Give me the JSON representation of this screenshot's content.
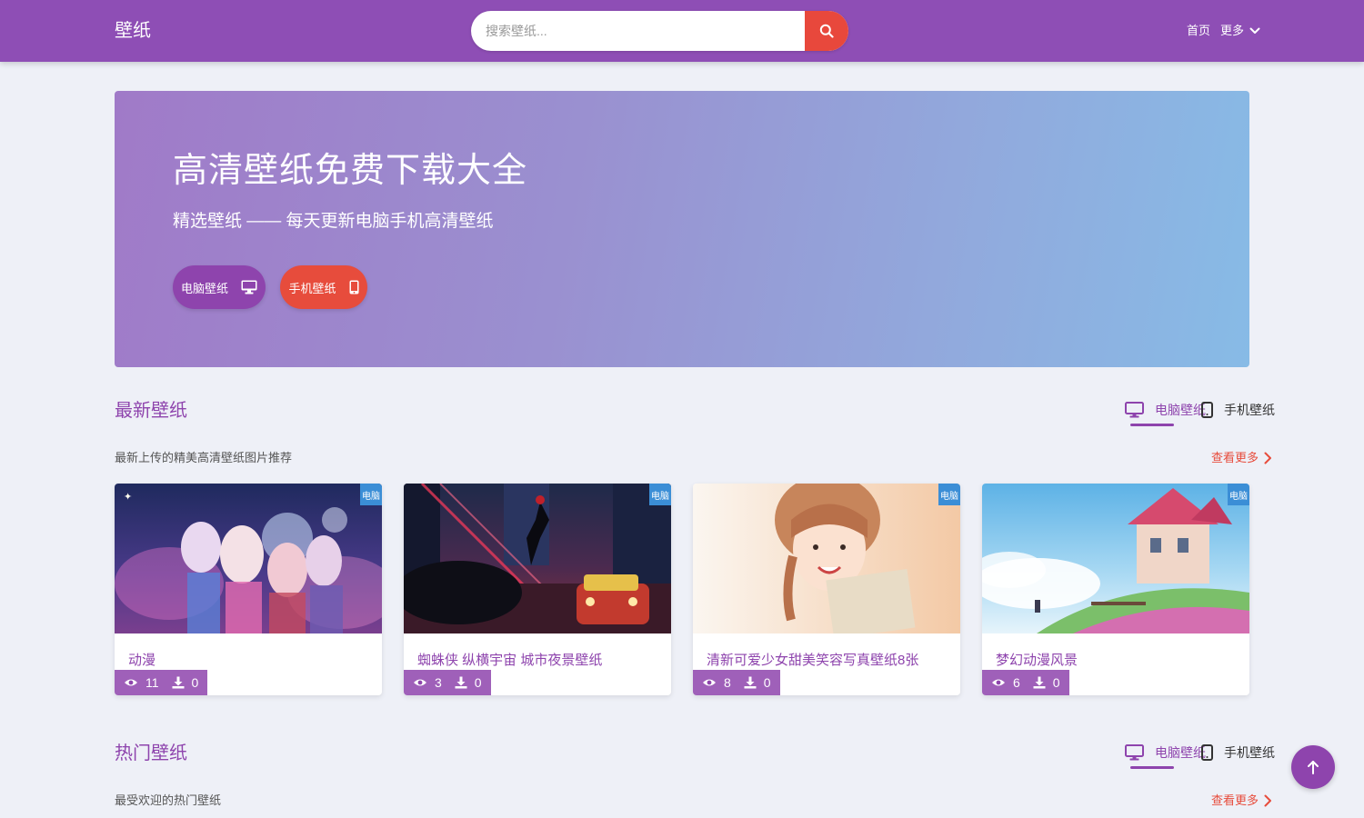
{
  "header": {
    "logo": "壁纸",
    "search_placeholder": "搜索壁纸...",
    "nav_home": "首页",
    "nav_more": "更多"
  },
  "hero": {
    "title": "高清壁纸免费下载大全",
    "subtitle": "精选壁纸 —— 每天更新电脑手机高清壁纸",
    "pc_button": "电脑壁纸",
    "mobile_button": "手机壁纸"
  },
  "sections": [
    {
      "title": "最新壁纸",
      "tab_pc": "电脑壁纸",
      "tab_mobile": "手机壁纸",
      "description": "最新上传的精美高清壁纸图片推荐",
      "more": "查看更多",
      "cards": [
        {
          "title": "动漫",
          "views": "11",
          "downloads": "0",
          "badge": "电脑"
        },
        {
          "title": "蜘蛛侠 纵横宇宙 城市夜景壁纸",
          "views": "3",
          "downloads": "0",
          "badge": "电脑"
        },
        {
          "title": "清新可爱少女甜美笑容写真壁纸8张",
          "views": "8",
          "downloads": "0",
          "badge": "电脑"
        },
        {
          "title": "梦幻动漫风景",
          "views": "6",
          "downloads": "0",
          "badge": "电脑"
        }
      ]
    },
    {
      "title": "热门壁纸",
      "tab_pc": "电脑壁纸",
      "tab_mobile": "手机壁纸",
      "description": "最受欢迎的热门壁纸",
      "more": "查看更多"
    }
  ],
  "colors": {
    "primary": "#8e44ad",
    "accent": "#e74c3c",
    "badge": "#3b8ed6",
    "background": "#eef0f7"
  },
  "icons": {
    "search": "search-icon",
    "pc": "desktop-icon",
    "mobile": "mobile-icon",
    "views": "eye-icon",
    "downloads": "download-icon",
    "more": "chevron-right-icon",
    "back_top": "arrow-up-icon"
  }
}
